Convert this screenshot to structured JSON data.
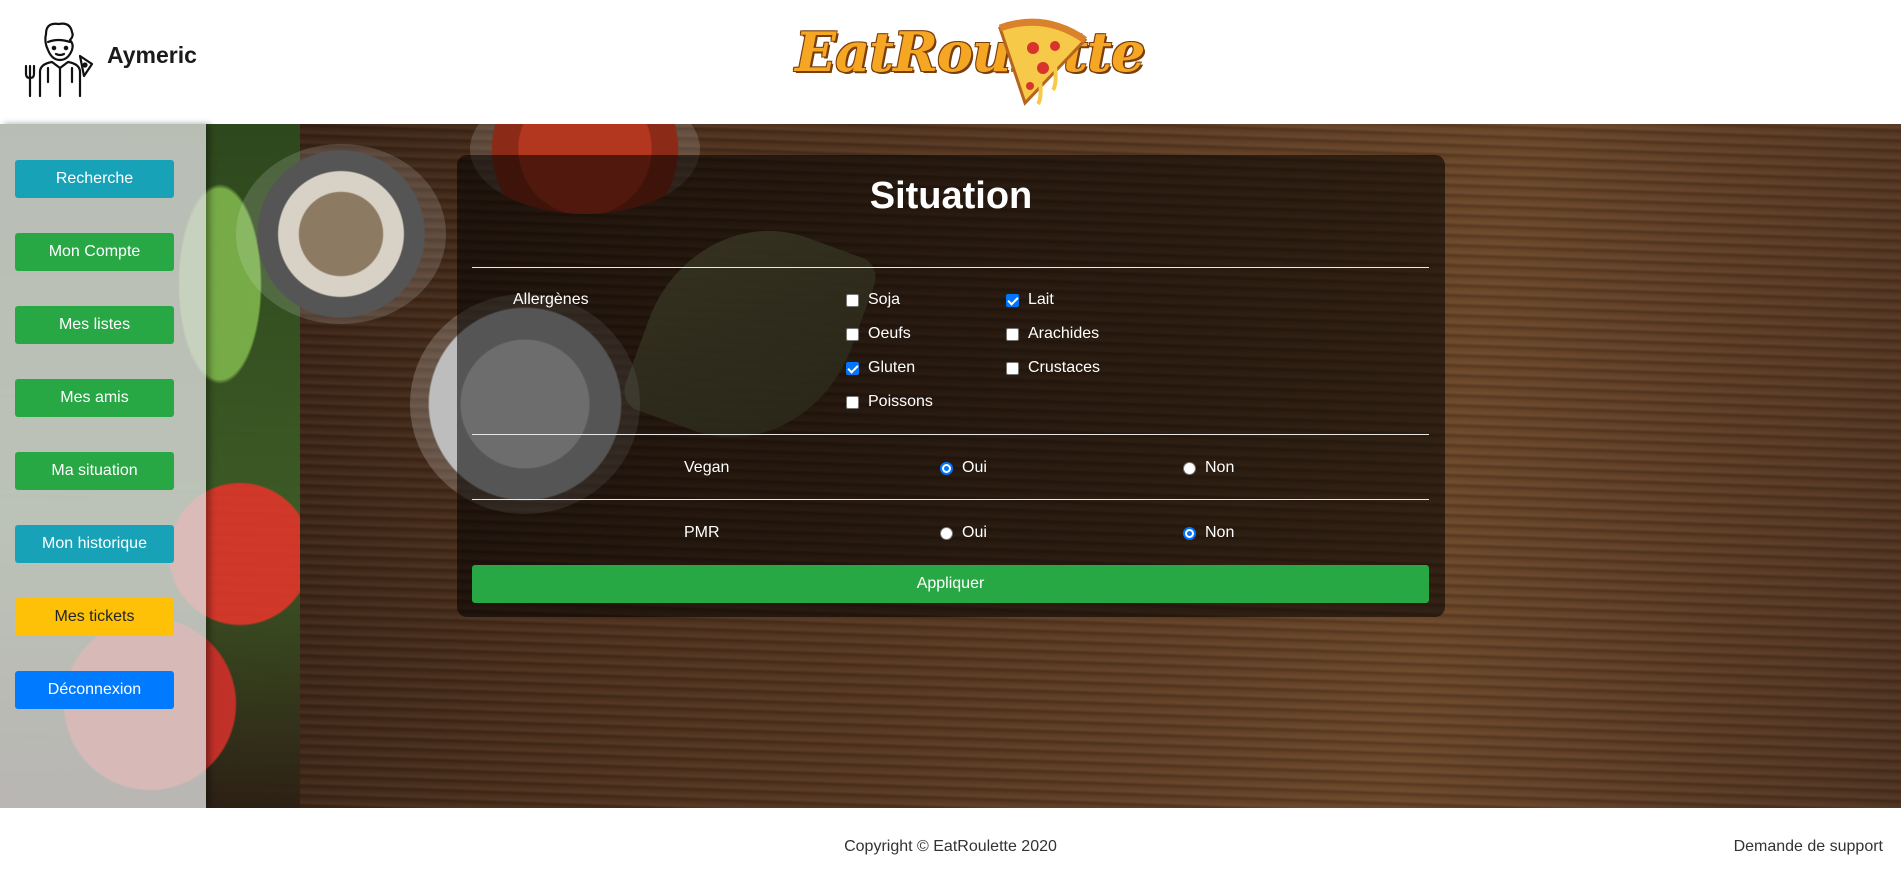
{
  "header": {
    "username": "Aymeric",
    "logo_text": "EatRoulette"
  },
  "sidebar": {
    "items": [
      {
        "label": "Recherche",
        "variant": "info"
      },
      {
        "label": "Mon Compte",
        "variant": "success"
      },
      {
        "label": "Mes listes",
        "variant": "success"
      },
      {
        "label": "Mes amis",
        "variant": "success"
      },
      {
        "label": "Ma situation",
        "variant": "success"
      },
      {
        "label": "Mon historique",
        "variant": "info"
      },
      {
        "label": "Mes tickets",
        "variant": "warning"
      },
      {
        "label": "Déconnexion",
        "variant": "primary"
      }
    ]
  },
  "panel": {
    "title": "Situation",
    "allergens": {
      "label": "Allergènes",
      "options": [
        {
          "label": "Soja",
          "checked": false
        },
        {
          "label": "Lait",
          "checked": true
        },
        {
          "label": "Oeufs",
          "checked": false
        },
        {
          "label": "Arachides",
          "checked": false
        },
        {
          "label": "Gluten",
          "checked": true
        },
        {
          "label": "Crustaces",
          "checked": false
        },
        {
          "label": "Poissons",
          "checked": false
        }
      ]
    },
    "vegan": {
      "label": "Vegan",
      "yes": "Oui",
      "no": "Non",
      "value": "Oui"
    },
    "pmr": {
      "label": "PMR",
      "yes": "Oui",
      "no": "Non",
      "value": "Non"
    },
    "apply_label": "Appliquer"
  },
  "footer": {
    "copyright": "Copyright © EatRoulette 2020",
    "support": "Demande de support"
  },
  "colors": {
    "info": "#17a2b8",
    "success": "#28a745",
    "warning": "#ffc107",
    "primary": "#007bff",
    "radio_checked": "#0075ff"
  },
  "icons": {
    "avatar": "chef-avatar-icon",
    "logo": "pizza-logo-icon"
  }
}
